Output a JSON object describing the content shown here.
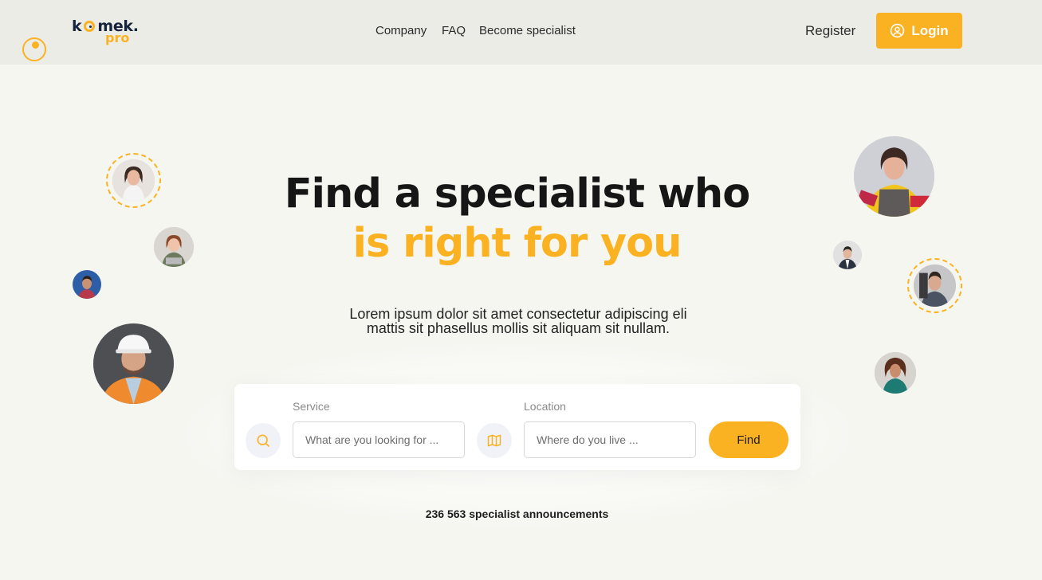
{
  "brand": {
    "logo_top": "kmek.",
    "logo_bottom": "pro",
    "accent": "#fbb222",
    "dark": "#16233c"
  },
  "nav": {
    "items": [
      "Company",
      "FAQ",
      "Become specialist"
    ]
  },
  "auth": {
    "register": "Register",
    "login": "Login"
  },
  "hero": {
    "title_line1": "Find a specialist who",
    "title_line2": "is right for you",
    "subtitle_line1": "Lorem ipsum dolor sit amet consectetur adipiscing eli",
    "subtitle_line2": "mattis sit phasellus mollis sit aliquam sit nullam."
  },
  "search": {
    "service_label": "Service",
    "service_placeholder": "What are you looking for ...",
    "location_label": "Location",
    "location_placeholder": "Where do you live ...",
    "find_label": "Find"
  },
  "stats": {
    "announcements": "236 563 specialist announcements"
  },
  "icons": {
    "search": "search-icon",
    "map": "map-icon",
    "user": "user-circle-icon"
  },
  "avatars": [
    {
      "name": "avatar-woman-smiling",
      "ring": true
    },
    {
      "name": "avatar-woman-laptop",
      "ring": false
    },
    {
      "name": "avatar-man-small",
      "ring": false
    },
    {
      "name": "avatar-construction-worker",
      "ring": false
    },
    {
      "name": "avatar-cleaner-woman",
      "ring": false
    },
    {
      "name": "avatar-man-suit",
      "ring": false
    },
    {
      "name": "avatar-mechanic-man",
      "ring": true
    },
    {
      "name": "avatar-woman-curly",
      "ring": false
    }
  ]
}
